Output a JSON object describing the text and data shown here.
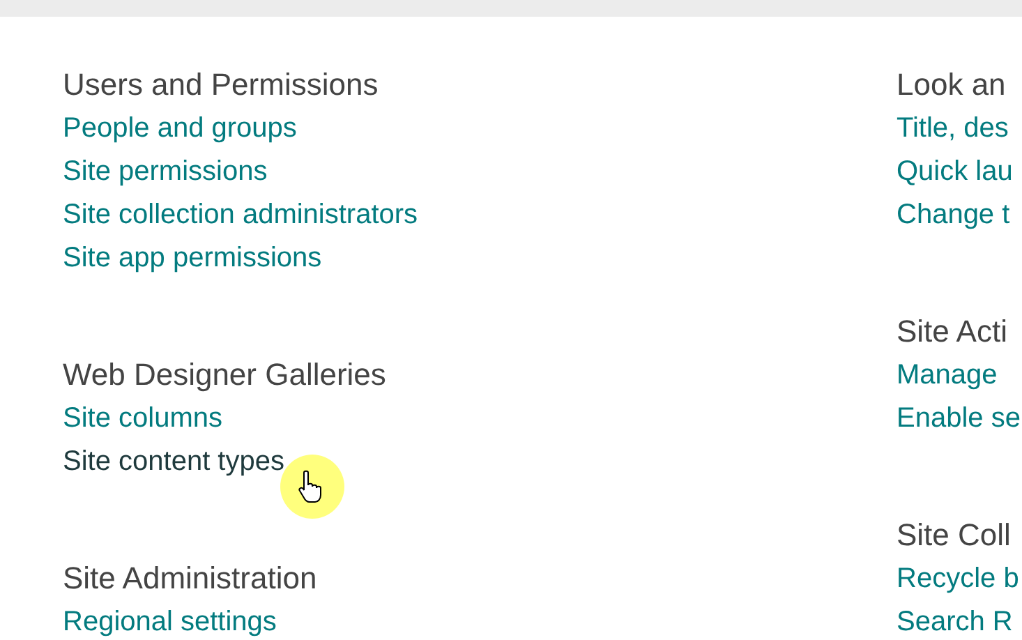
{
  "columns": [
    {
      "groups": [
        {
          "heading": "Users and Permissions",
          "links": [
            {
              "label": "People and groups",
              "hovered": false
            },
            {
              "label": "Site permissions",
              "hovered": false
            },
            {
              "label": "Site collection administrators",
              "hovered": false
            },
            {
              "label": "Site app permissions",
              "hovered": false
            }
          ]
        },
        {
          "heading": "Web Designer Galleries",
          "links": [
            {
              "label": "Site columns",
              "hovered": false
            },
            {
              "label": "Site content types",
              "hovered": true
            }
          ]
        },
        {
          "heading": "Site Administration",
          "links": [
            {
              "label": "Regional settings",
              "hovered": false
            }
          ]
        }
      ]
    },
    {
      "groups": [
        {
          "heading": "Look an",
          "links": [
            {
              "label": "Title, des",
              "hovered": false
            },
            {
              "label": "Quick lau",
              "hovered": false
            },
            {
              "label": "Change t",
              "hovered": false
            }
          ]
        },
        {
          "heading": "Site Acti",
          "links": [
            {
              "label": "Manage",
              "hovered": false
            },
            {
              "label": "Enable se",
              "hovered": false
            }
          ]
        },
        {
          "heading": "Site Coll",
          "links": [
            {
              "label": "Recycle b",
              "hovered": false
            },
            {
              "label": "Search R",
              "hovered": false
            }
          ]
        }
      ]
    }
  ]
}
